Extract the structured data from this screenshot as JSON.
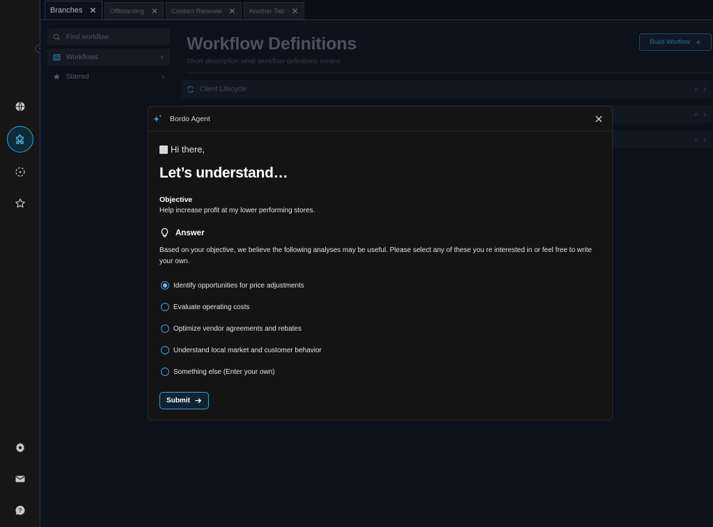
{
  "tabs": [
    {
      "label": "Branches",
      "active": true
    },
    {
      "label": "Offboarding",
      "active": false
    },
    {
      "label": "Contact Renewal",
      "active": false
    },
    {
      "label": "Another Tab",
      "active": false
    }
  ],
  "rail": {
    "top_icons": [
      "globe-icon",
      "puzzle-icon",
      "target-icon",
      "star-icon"
    ],
    "bottom_icons": [
      "gear-icon",
      "mail-icon",
      "help-icon"
    ],
    "accent_color": "#3aa0d8"
  },
  "sidebar": {
    "search_placeholder": "Find workflow",
    "items": [
      {
        "label": "Workflows",
        "icon": "list-icon",
        "trail": "+"
      },
      {
        "label": "Starred",
        "icon": "star-icon",
        "trail": "›"
      }
    ]
  },
  "main": {
    "title": "Workflow Definitions",
    "subtitle": "Short description what workflow definitions means",
    "build_button": "Build Worflow",
    "rows": [
      {
        "label": "Client Lifecycle"
      },
      {
        "label": ""
      },
      {
        "label": ""
      }
    ]
  },
  "modal": {
    "title": "Bordo Agent",
    "greeting": "Hi there,",
    "headline": "Let’s understand…",
    "objective_label": "Objective",
    "objective_text": "Help increase profit at my lower performing stores.",
    "answer_label": "Answer",
    "answer_text": "Based on your objective, we believe the  following analyses may be useful. Please select any of these you re interested in or feel free to write your own.",
    "options": [
      {
        "label": "Identify opportunities for price adjustments",
        "selected": true
      },
      {
        "label": "Evaluate operating costs",
        "selected": false
      },
      {
        "label": "Optimize  vendor agreements and rebates",
        "selected": false
      },
      {
        "label": "Understand local market and customer behavior",
        "selected": false
      },
      {
        "label": "Something else (Enter your own)",
        "selected": false
      }
    ],
    "submit_label": "Submit"
  }
}
